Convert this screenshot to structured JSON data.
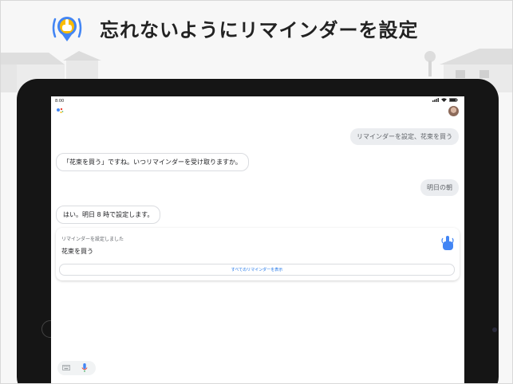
{
  "headline": {
    "text": "忘れないようにリマインダーを設定"
  },
  "status_bar": {
    "time": "8:00"
  },
  "conversation": {
    "user_message_1": "リマインダーを設定、花束を買う",
    "assistant_message_1": "「花束を買う」ですね。いつリマインダーを受け取りますか。",
    "user_message_2": "明日の朝",
    "assistant_message_2": "はい。明日 8 時で設定します。"
  },
  "reminder_card": {
    "caption": "リマインダーを設定しました",
    "item": "花束を買う",
    "button_label": "すべてのリマインダーを表示"
  },
  "colors": {
    "accent_blue": "#1a73e8",
    "user_bubble": "#ebedf0",
    "tablet_bezel": "#151515"
  },
  "icons": [
    "hand-tap-icon",
    "assistant-logo-icon",
    "avatar",
    "keyboard-icon",
    "mic-icon"
  ]
}
